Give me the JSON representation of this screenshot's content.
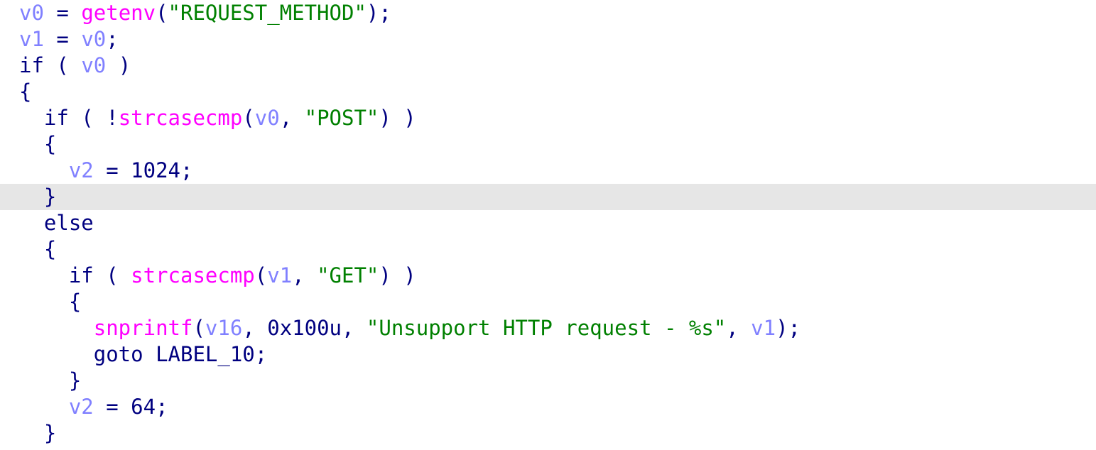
{
  "colors": {
    "background": "#ffffff",
    "highlight": "#e6e6e6",
    "keyword": "#000080",
    "variable": "#8080ff",
    "function": "#ff00ff",
    "string": "#008000",
    "number": "#000080",
    "punctuation": "#000080"
  },
  "highlighted_line": 7,
  "lines": [
    [
      {
        "t": "var",
        "v": "v0"
      },
      {
        "t": "punc",
        "v": " = "
      },
      {
        "t": "fn",
        "v": "getenv"
      },
      {
        "t": "punc",
        "v": "("
      },
      {
        "t": "str",
        "v": "\"REQUEST_METHOD\""
      },
      {
        "t": "punc",
        "v": ");"
      }
    ],
    [
      {
        "t": "var",
        "v": "v1"
      },
      {
        "t": "punc",
        "v": " = "
      },
      {
        "t": "var",
        "v": "v0"
      },
      {
        "t": "punc",
        "v": ";"
      }
    ],
    [
      {
        "t": "kw",
        "v": "if"
      },
      {
        "t": "punc",
        "v": " ( "
      },
      {
        "t": "var",
        "v": "v0"
      },
      {
        "t": "punc",
        "v": " )"
      }
    ],
    [
      {
        "t": "punc",
        "v": "{"
      }
    ],
    [
      {
        "t": "punc",
        "v": "  "
      },
      {
        "t": "kw",
        "v": "if"
      },
      {
        "t": "punc",
        "v": " ( !"
      },
      {
        "t": "fn",
        "v": "strcasecmp"
      },
      {
        "t": "punc",
        "v": "("
      },
      {
        "t": "var",
        "v": "v0"
      },
      {
        "t": "punc",
        "v": ", "
      },
      {
        "t": "str",
        "v": "\"POST\""
      },
      {
        "t": "punc",
        "v": ") )"
      }
    ],
    [
      {
        "t": "punc",
        "v": "  {"
      }
    ],
    [
      {
        "t": "punc",
        "v": "    "
      },
      {
        "t": "var",
        "v": "v2"
      },
      {
        "t": "punc",
        "v": " = "
      },
      {
        "t": "num",
        "v": "1024"
      },
      {
        "t": "punc",
        "v": ";"
      }
    ],
    [
      {
        "t": "punc",
        "v": "  }"
      }
    ],
    [
      {
        "t": "punc",
        "v": "  "
      },
      {
        "t": "kw",
        "v": "else"
      }
    ],
    [
      {
        "t": "punc",
        "v": "  {"
      }
    ],
    [
      {
        "t": "punc",
        "v": "    "
      },
      {
        "t": "kw",
        "v": "if"
      },
      {
        "t": "punc",
        "v": " ( "
      },
      {
        "t": "fn",
        "v": "strcasecmp"
      },
      {
        "t": "punc",
        "v": "("
      },
      {
        "t": "var",
        "v": "v1"
      },
      {
        "t": "punc",
        "v": ", "
      },
      {
        "t": "str",
        "v": "\"GET\""
      },
      {
        "t": "punc",
        "v": ") )"
      }
    ],
    [
      {
        "t": "punc",
        "v": "    {"
      }
    ],
    [
      {
        "t": "punc",
        "v": "      "
      },
      {
        "t": "fn",
        "v": "snprintf"
      },
      {
        "t": "punc",
        "v": "("
      },
      {
        "t": "var",
        "v": "v16"
      },
      {
        "t": "punc",
        "v": ", "
      },
      {
        "t": "num",
        "v": "0x100u"
      },
      {
        "t": "punc",
        "v": ", "
      },
      {
        "t": "str",
        "v": "\"Unsupport HTTP request - %s\""
      },
      {
        "t": "punc",
        "v": ", "
      },
      {
        "t": "var",
        "v": "v1"
      },
      {
        "t": "punc",
        "v": ");"
      }
    ],
    [
      {
        "t": "punc",
        "v": "      "
      },
      {
        "t": "kw",
        "v": "goto"
      },
      {
        "t": "punc",
        "v": " "
      },
      {
        "t": "kw",
        "v": "LABEL_10"
      },
      {
        "t": "punc",
        "v": ";"
      }
    ],
    [
      {
        "t": "punc",
        "v": "    }"
      }
    ],
    [
      {
        "t": "punc",
        "v": "    "
      },
      {
        "t": "var",
        "v": "v2"
      },
      {
        "t": "punc",
        "v": " = "
      },
      {
        "t": "num",
        "v": "64"
      },
      {
        "t": "punc",
        "v": ";"
      }
    ],
    [
      {
        "t": "punc",
        "v": "  }"
      }
    ]
  ]
}
